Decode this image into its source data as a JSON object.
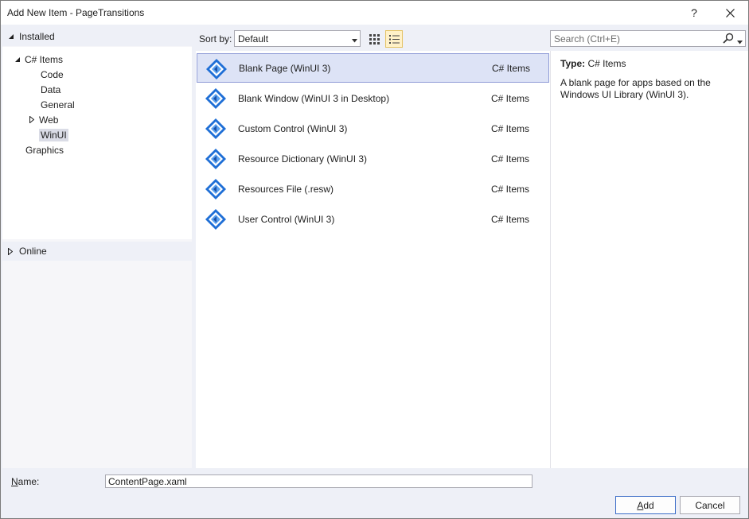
{
  "window": {
    "title": "Add New Item - PageTransitions",
    "help_glyph": "?"
  },
  "left": {
    "installed_label": "Installed",
    "tree": [
      {
        "label": "C# Items",
        "expanded": true
      },
      {
        "label": "Code"
      },
      {
        "label": "Data"
      },
      {
        "label": "General"
      },
      {
        "label": "Web",
        "collapsed": true
      },
      {
        "label": "WinUI",
        "selected": true
      },
      {
        "label": "Graphics"
      }
    ],
    "online_label": "Online"
  },
  "toolbar": {
    "sort_label": "Sort by:",
    "sort_value": "Default",
    "search_placeholder": "Search (Ctrl+E)"
  },
  "items": [
    {
      "name": "Blank Page (WinUI 3)",
      "category": "C# Items",
      "selected": true
    },
    {
      "name": "Blank Window (WinUI 3 in Desktop)",
      "category": "C# Items"
    },
    {
      "name": "Custom Control (WinUI 3)",
      "category": "C# Items"
    },
    {
      "name": "Resource Dictionary (WinUI 3)",
      "category": "C# Items"
    },
    {
      "name": "Resources File (.resw)",
      "category": "C# Items"
    },
    {
      "name": "User Control (WinUI 3)",
      "category": "C# Items"
    }
  ],
  "details": {
    "type_key": "Type:",
    "type_value": "C# Items",
    "description": "A blank page for apps based on the Windows UI Library (WinUI 3)."
  },
  "bottom": {
    "name_label_rest": "ame:",
    "name_label_mnemonic": "N",
    "name_value": "ContentPage.xaml",
    "add_mnemonic": "A",
    "add_rest": "dd",
    "cancel_label": "Cancel"
  },
  "colors": {
    "selection_bg": "#dde3f6",
    "selection_border": "#8e9ad6",
    "icon_blue": "#1f6fd6"
  }
}
